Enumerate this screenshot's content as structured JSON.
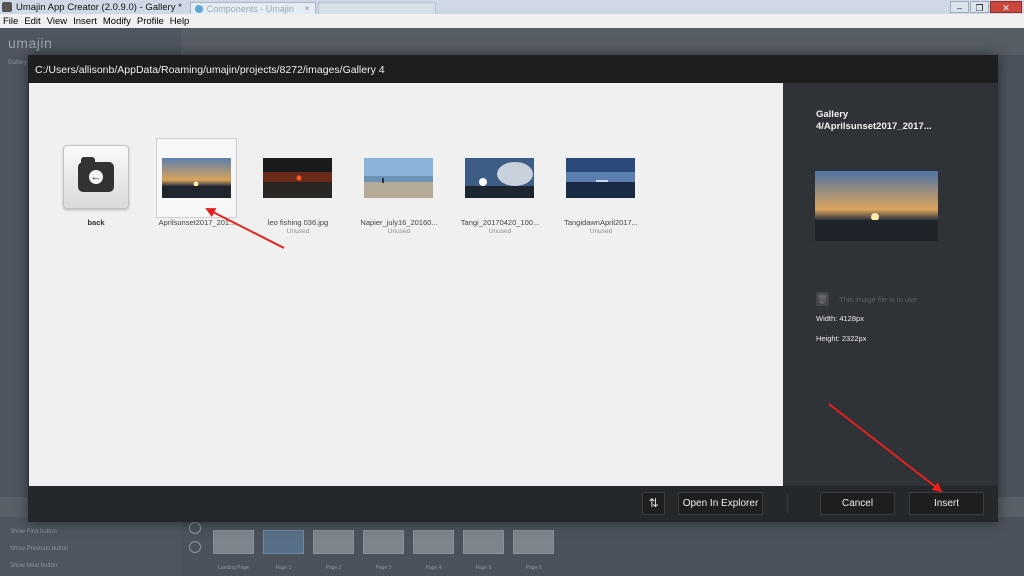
{
  "window": {
    "title": "Umajin App Creator (2.0.9.0) - Gallery *",
    "tab_label": "Components - Umajin",
    "tab_close": "×",
    "buttons": {
      "minimize": "–",
      "restore": "❐",
      "close": "✕"
    }
  },
  "menu": [
    "File",
    "Edit",
    "View",
    "Insert",
    "Modify",
    "Profile",
    "Help"
  ],
  "background": {
    "logo": "umajin",
    "labels": [
      "Gallery",
      "Show First button",
      "Show Previous button",
      "Show Next button"
    ],
    "pages": [
      "Landing Page",
      "Page 1",
      "Page 2",
      "Page 3",
      "Page 4",
      "Page 5",
      "Page 6"
    ]
  },
  "dialog": {
    "path": "C:/Users/allisonb/AppData/Roaming/umajin/projects/8272/images/Gallery 4",
    "back_label": "back",
    "images": [
      {
        "name": "Aprilsunset2017_201...",
        "status": "",
        "selected": true,
        "theme": "sunset"
      },
      {
        "name": "leo fishing 036.jpg",
        "status": "Unused",
        "selected": false,
        "theme": "dusk"
      },
      {
        "name": "Napier_july16_20160...",
        "status": "Unused",
        "selected": false,
        "theme": "beach"
      },
      {
        "name": "Tangi_20170420_100...",
        "status": "Unused",
        "selected": false,
        "theme": "cloud"
      },
      {
        "name": "TangidawnApril2017...",
        "status": "Unused",
        "selected": false,
        "theme": "dawn"
      }
    ],
    "info": {
      "title": "Gallery 4/Aprilsunset2017_2017...",
      "in_use_text": "This image file is in use",
      "width": "Width: 4128px",
      "height": "Height: 2322px"
    },
    "footer": {
      "refresh_icon": "⇅",
      "open_explorer": "Open In Explorer",
      "cancel": "Cancel",
      "insert": "Insert"
    }
  },
  "colors": {
    "annotation_arrow": "#e8201c",
    "dialog_bg": "#2b2e31",
    "grid_bg": "#f0f0f0"
  }
}
